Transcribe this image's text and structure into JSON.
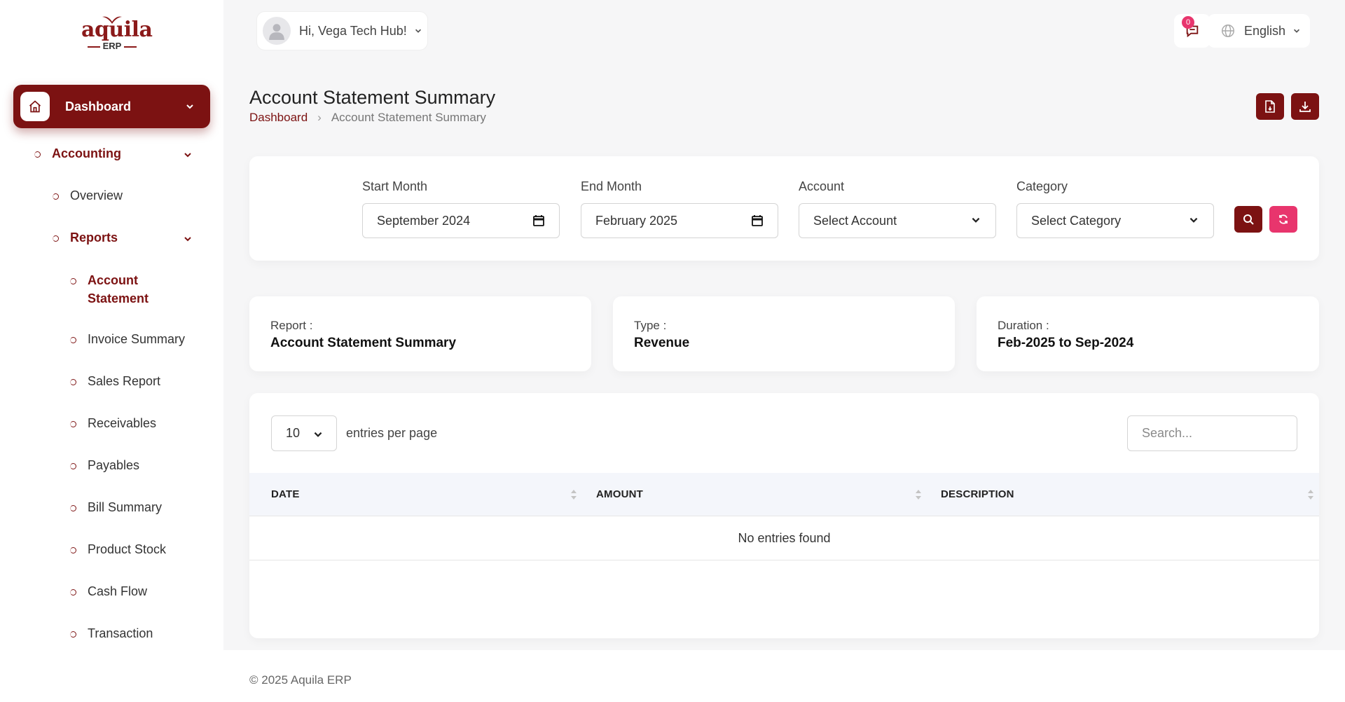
{
  "app": {
    "logo_word": "aquila",
    "logo_sub": "ERP",
    "brand_color": "#7c1212",
    "accent_pink": "#e8356d"
  },
  "header": {
    "greeting": "Hi, Vega Tech Hub!",
    "notification_count": "0",
    "language": "English"
  },
  "sidebar": {
    "dashboard_label": "Dashboard",
    "accounting_label": "Accounting",
    "overview_label": "Overview",
    "reports_label": "Reports",
    "report_items": [
      "Account Statement",
      "Invoice Summary",
      "Sales Report",
      "Receivables",
      "Payables",
      "Bill Summary",
      "Product Stock",
      "Cash Flow",
      "Transaction"
    ]
  },
  "page": {
    "title": "Account Statement Summary",
    "breadcrumb": {
      "root": "Dashboard",
      "current": "Account Statement Summary"
    }
  },
  "filters": {
    "start_month_label": "Start Month",
    "start_month_value": "September 2024",
    "end_month_label": "End Month",
    "end_month_value": "February 2025",
    "account_label": "Account",
    "account_value": "Select Account",
    "category_label": "Category",
    "category_value": "Select Category"
  },
  "summary": {
    "report_label": "Report :",
    "report_value": "Account Statement Summary",
    "type_label": "Type :",
    "type_value": "Revenue",
    "duration_label": "Duration :",
    "duration_value": "Feb-2025 to Sep-2024"
  },
  "table": {
    "per_page_value": "10",
    "per_page_text": "entries per page",
    "search_placeholder": "Search...",
    "columns": [
      "DATE",
      "AMOUNT",
      "DESCRIPTION"
    ],
    "empty_text": "No entries found"
  },
  "footer": {
    "copyright": "© 2025 Aquila ERP"
  }
}
